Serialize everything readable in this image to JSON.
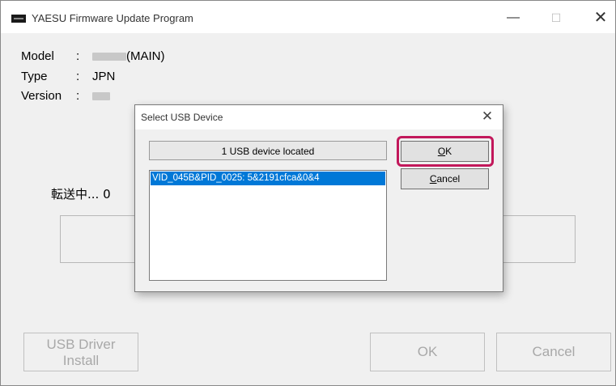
{
  "window": {
    "title": "YAESU Firmware Update Program",
    "controls": {
      "minimize": "—",
      "maximize": "☐",
      "close": "✕"
    }
  },
  "info": {
    "model_label": "Model",
    "model_value": "(MAIN)",
    "type_label": "Type",
    "type_value": "JPN",
    "version_label": "Version",
    "colon": ":"
  },
  "status": {
    "transfer_text": "転送中... 0"
  },
  "buttons": {
    "usb_driver_line1": "USB Driver",
    "usb_driver_line2": "Install",
    "ok": "OK",
    "cancel": "Cancel"
  },
  "dialog": {
    "title": "Select USB Device",
    "close": "✕",
    "located_text": "1 USB device located",
    "devices": [
      "VID_045B&PID_0025: 5&2191cfca&0&4"
    ],
    "ok_mnemonic": "O",
    "ok_rest": "K",
    "cancel_mnemonic": "C",
    "cancel_rest": "ancel",
    "highlight_color": "#c2185b",
    "selection_color": "#0078d7"
  }
}
